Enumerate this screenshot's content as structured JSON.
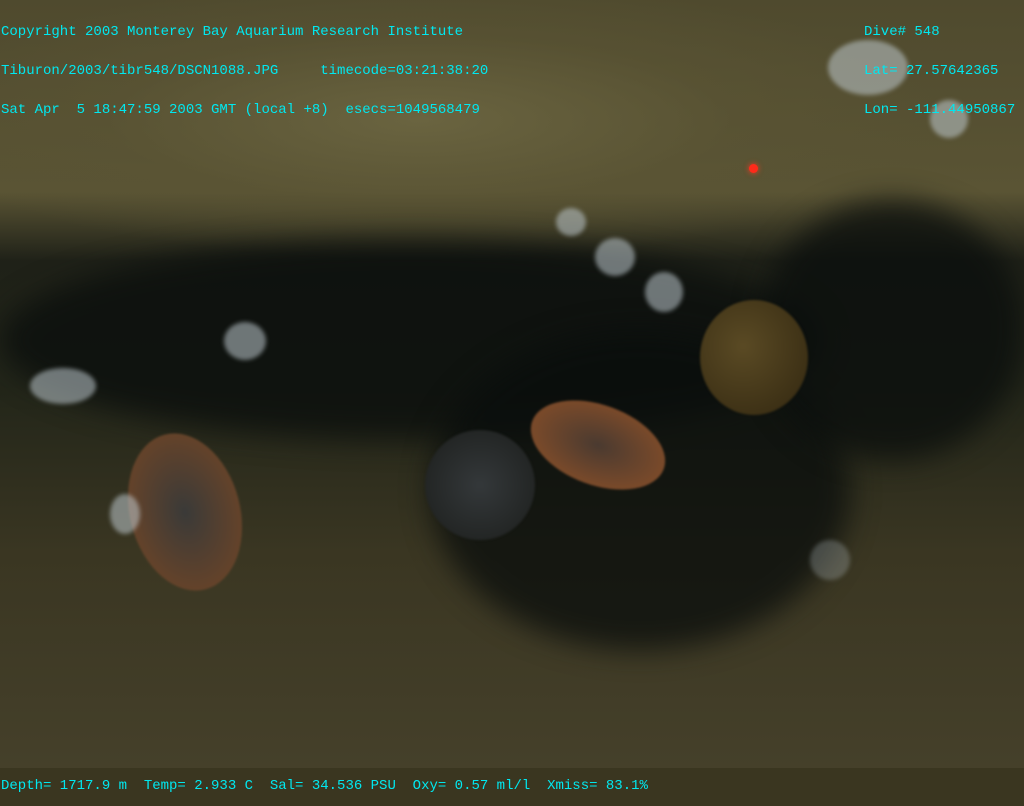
{
  "overlay_top_left": [
    "Copyright 2003 Monterey Bay Aquarium Research Institute",
    "Tiburon/2003/tibr548/DSCN1088.JPG     timecode=03:21:38:20",
    "Sat Apr  5 18:47:59 2003 GMT (local +8)  esecs=1049568479"
  ],
  "overlay_top_right": [
    "Dive# 548",
    "Lat= 27.57642365",
    "Lon= -111.44950867"
  ],
  "overlay_bottom": "Depth= 1717.9 m  Temp= 2.933 C  Sal= 34.536 PSU  Oxy= 0.57 ml/l  Xmiss= 83.1%",
  "colors": {
    "overlay_text": "#00e8f0",
    "laser": "#ff2a1a"
  }
}
